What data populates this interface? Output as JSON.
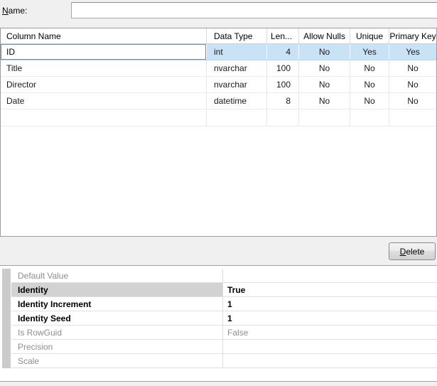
{
  "header": {
    "name_label": "Name:",
    "name_value": ""
  },
  "grid": {
    "columns": [
      {
        "label": "Column Name"
      },
      {
        "label": "Data Type"
      },
      {
        "label": "Len..."
      },
      {
        "label": "Allow Nulls"
      },
      {
        "label": "Unique"
      },
      {
        "label": "Primary Key"
      }
    ],
    "rows": [
      {
        "name": "ID",
        "type": "int",
        "length": "4",
        "allow_nulls": "No",
        "unique": "Yes",
        "primary_key": "Yes",
        "selected": true
      },
      {
        "name": "Title",
        "type": "nvarchar",
        "length": "100",
        "allow_nulls": "No",
        "unique": "No",
        "primary_key": "No"
      },
      {
        "name": "Director",
        "type": "nvarchar",
        "length": "100",
        "allow_nulls": "No",
        "unique": "No",
        "primary_key": "No"
      },
      {
        "name": "Date",
        "type": "datetime",
        "length": "8",
        "allow_nulls": "No",
        "unique": "No",
        "primary_key": "No"
      }
    ]
  },
  "toolbar": {
    "delete_label": "Delete"
  },
  "properties": {
    "rows": [
      {
        "label": "Default Value",
        "value": "",
        "state": "disabled"
      },
      {
        "label": "Identity",
        "value": "True",
        "state": "selected"
      },
      {
        "label": "Identity Increment",
        "value": "1",
        "state": "modified"
      },
      {
        "label": "Identity Seed",
        "value": "1",
        "state": "modified"
      },
      {
        "label": "Is RowGuid",
        "value": "False",
        "state": "disabled"
      },
      {
        "label": "Precision",
        "value": "",
        "state": "disabled"
      },
      {
        "label": "Scale",
        "value": "",
        "state": "disabled"
      }
    ]
  },
  "colors": {
    "selection_blue": "#c9e2f6",
    "selection_gray": "#d2d2d2",
    "grid_border": "#9c9c9c",
    "disabled_text": "#8e8e8e"
  }
}
